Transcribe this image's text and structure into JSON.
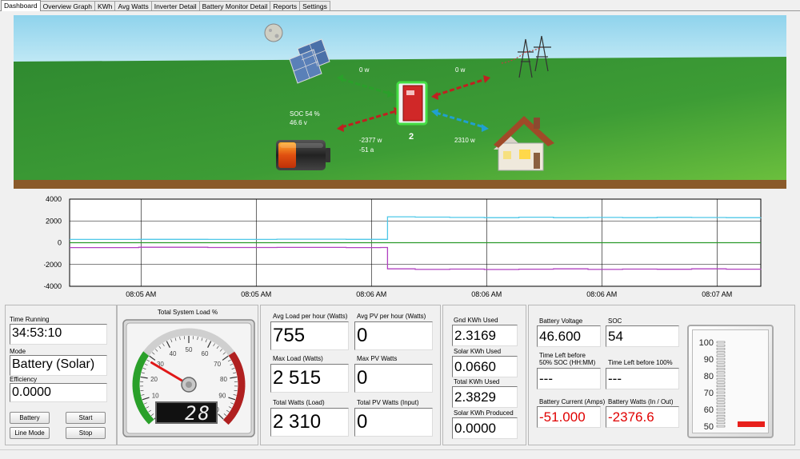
{
  "tabs": [
    "Dashboard",
    "Overview Graph",
    "KWh",
    "Avg Watts",
    "Inverter Detail",
    "Battery Monitor Detail",
    "Reports",
    "Settings"
  ],
  "active_tab": "Dashboard",
  "scene": {
    "pv_watts": "0 w",
    "grid_watts": "0 w",
    "soc_line": "SOC 54 %",
    "battery_volts": "46.6 v",
    "battery_watts": "-2377 w",
    "battery_amps": "-51 a",
    "load_watts": "2310 w",
    "inverter_number": "2"
  },
  "chart_data": {
    "type": "line",
    "title": "",
    "xlabel": "",
    "ylabel": "",
    "ylim": [
      -4000,
      4000
    ],
    "y_ticks": [
      4000,
      2000,
      0,
      -2000,
      -4000
    ],
    "x_tick_labels": [
      "08:05 AM",
      "08:05 AM",
      "08:06 AM",
      "08:06 AM",
      "08:06 AM",
      "08:07 AM"
    ],
    "grid": true,
    "x": [
      0,
      10,
      20,
      30,
      40,
      45,
      46,
      50,
      55,
      60,
      65,
      70,
      75,
      80,
      85,
      90,
      95,
      100
    ],
    "series": [
      {
        "color": "#4fc8e8",
        "values": [
          300,
          310,
          300,
          320,
          310,
          310,
          2380,
          2350,
          2320,
          2300,
          2340,
          2300,
          2320,
          2300,
          2330,
          2310,
          2300,
          2310
        ]
      },
      {
        "color": "#b040c0",
        "values": [
          -450,
          -420,
          -440,
          -430,
          -450,
          -440,
          -2400,
          -2450,
          -2420,
          -2460,
          -2430,
          -2400,
          -2450,
          -2420,
          -2440,
          -2400,
          -2430,
          -2410
        ]
      },
      {
        "color": "#2a9a2a",
        "values": [
          0,
          0,
          0,
          0,
          0,
          0,
          0,
          0,
          0,
          0,
          0,
          0,
          0,
          0,
          0,
          0,
          0,
          0
        ]
      }
    ]
  },
  "left_panel": {
    "time_running_label": "Time Running",
    "time_running": "34:53:10",
    "mode_label": "Mode",
    "mode": "Battery (Solar)",
    "efficiency_label": "Efficiency",
    "efficiency": "0.0000",
    "btn_battery": "Battery",
    "btn_start": "Start",
    "btn_line_mode": "Line Mode",
    "btn_stop": "Stop"
  },
  "gauge": {
    "title": "Total System Load %",
    "value": 28,
    "readout": "28",
    "ticks": [
      "0",
      "10",
      "20",
      "30",
      "40",
      "50",
      "60",
      "70",
      "80",
      "90",
      "100"
    ]
  },
  "load_panel": {
    "avg_load_label": "Avg Load per hour (Watts)",
    "avg_load": "755",
    "avg_pv_label": "Avg PV per hour (Watts)",
    "avg_pv": "0",
    "max_load_label": "Max Load (Watts)",
    "max_load": "2 515",
    "max_pv_label": "Max PV Watts",
    "max_pv": "0",
    "total_load_label": "Total Watts (Load)",
    "total_load": "2 310",
    "total_pv_label": "Total PV Watts (Input)",
    "total_pv": "0"
  },
  "kwh_panel": {
    "gnd_label": "Gnd KWh Used",
    "gnd": "2.3169",
    "solar_used_label": "Solar KWh Used",
    "solar_used": "0.0660",
    "total_used_label": "Total KWh Used",
    "total_used": "2.3829",
    "solar_produced_label": "Solar KWh Produced",
    "solar_produced": "0.0000"
  },
  "battery_panel": {
    "voltage_label": "Battery Voltage",
    "voltage": "46.600",
    "soc_label": "SOC",
    "soc": "54",
    "left50_label_1": "Time Left before",
    "left50_label_2": "50% SOC (HH:MM)",
    "left50": "---",
    "left100_label": "Time Left before 100%",
    "left100": "---",
    "current_label": "Battery Current (Amps)",
    "current": "-51.000",
    "watts_label": "Battery Watts (In / Out)",
    "watts": "-2376.6"
  },
  "soc_meter": {
    "value": 54,
    "ticks": [
      "100",
      "90",
      "80",
      "70",
      "60",
      "50"
    ],
    "bar_color": "#e8201c"
  }
}
